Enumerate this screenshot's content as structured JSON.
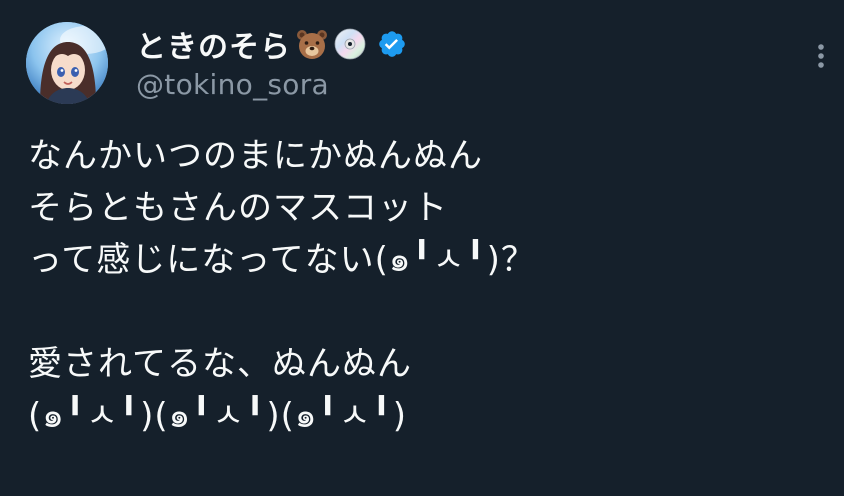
{
  "author": {
    "display_name": "ときのそら",
    "handle": "@tokino_sora",
    "emojis": [
      {
        "name": "bear-emoji",
        "glyph": "🐻"
      },
      {
        "name": "disc-emoji",
        "glyph": "💿"
      }
    ],
    "verified_color": "#1d9bf0"
  },
  "tweet": {
    "lines": [
      "なんかいつのまにかぬんぬん",
      "そらともさんのマスコット",
      "って感じになってない(๑╹ㅅ╹)？",
      "",
      "愛されてるな、ぬんぬん",
      "(๑╹ㅅ╹)(๑╹ㅅ╹)(๑╹ㅅ╹)"
    ]
  },
  "colors": {
    "background": "#15202b",
    "text": "#f7f9f9",
    "secondary_text": "#8b98a5"
  }
}
